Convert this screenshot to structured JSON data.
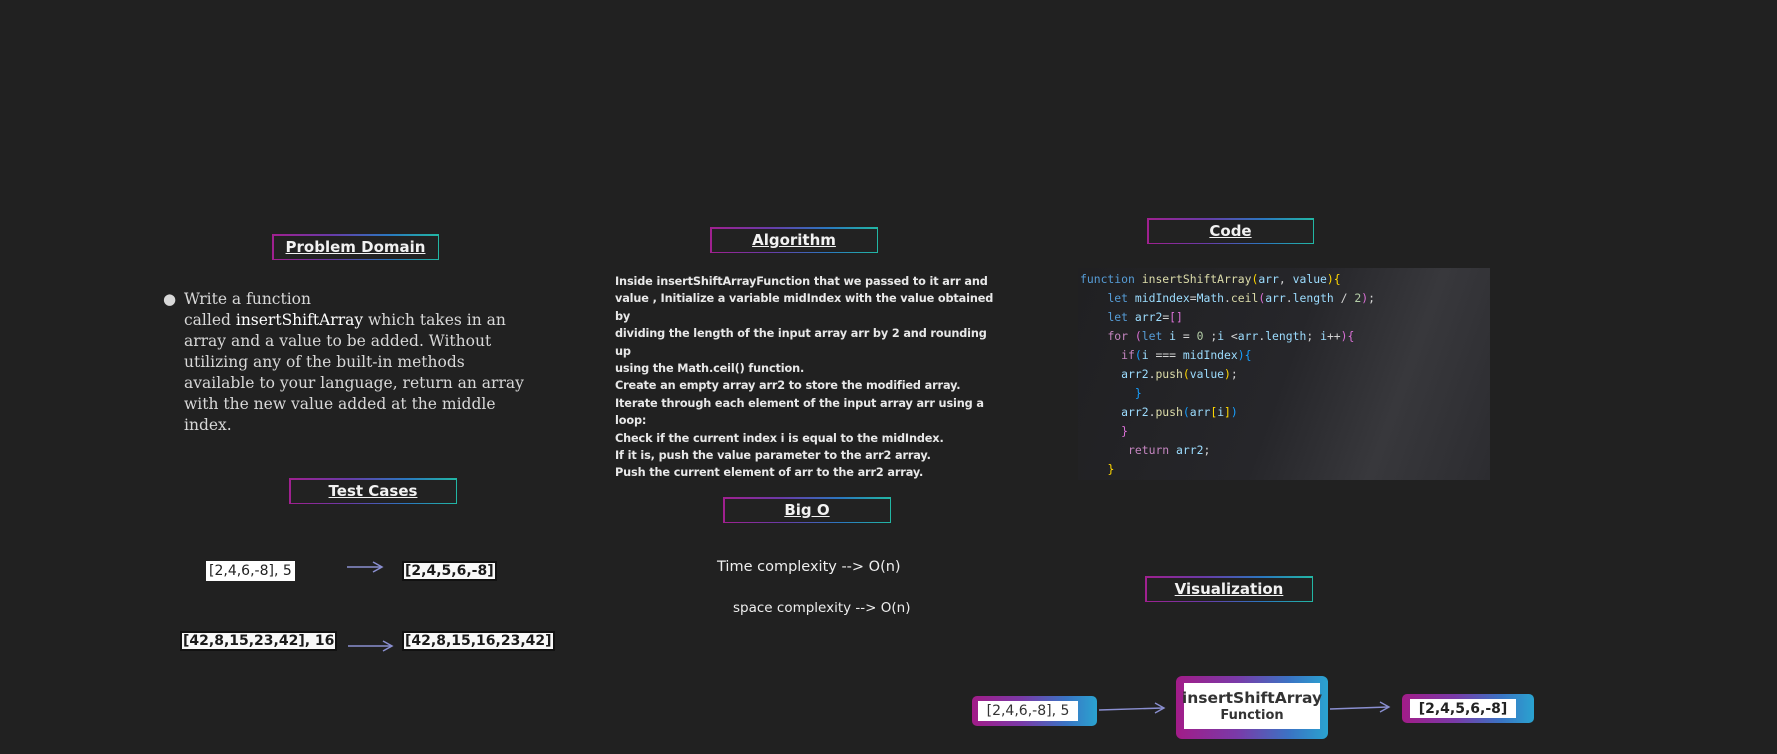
{
  "headers": {
    "problem_domain": "Problem Domain",
    "algorithm": "Algorithm",
    "code": "Code",
    "test_cases": "Test Cases",
    "big_o": "Big O",
    "visualization": "Visualization"
  },
  "problem_domain": {
    "line1": "Write a function",
    "line2_pre": "called ",
    "fn_name": "insertShiftArray",
    "line2_post": " which takes in an",
    "rest": [
      "array and a value to be added. Without",
      "utilizing any of the built-in methods",
      "available to your language, return an array",
      "with the new value added at the middle",
      "index."
    ]
  },
  "algorithm": {
    "lines": [
      "Inside insertShiftArrayFunction that we passed to it arr and",
      "value , Initialize a variable midIndex with the value obtained by",
      "dividing the length of the input array arr by 2 and rounding up",
      "using the Math.ceil() function.",
      "Create an empty array arr2 to store the modified array.",
      "Iterate through each element of the input array arr using a",
      "loop:",
      "Check if the current index i is equal to the midIndex.",
      "If it is, push the value parameter to the arr2 array.",
      "Push the current element of arr to the arr2 array."
    ]
  },
  "code": {
    "lines": [
      "function insertShiftArray(arr, value){",
      "    let midIndex=Math.ceil(arr.length / 2);",
      "    let arr2=[]",
      "    for (let i = 0 ;i <arr.length; i++){",
      "      if(i === midIndex){",
      "      arr2.push(value);",
      "        }",
      "      arr2.push(arr[i])",
      "      }",
      "       return arr2;",
      "    }"
    ]
  },
  "test_cases": [
    {
      "input": "[2,4,6,-8], 5",
      "output": "[2,4,5,6,-8]"
    },
    {
      "input": "[42,8,15,23,42], 16",
      "output": "[42,8,15,16,23,42]"
    }
  ],
  "big_o": {
    "time": "Time complexity --> O(n)",
    "space": "space complexity --> O(n)"
  },
  "visualization": {
    "input": "[2,4,6,-8], 5",
    "function_name": "insertShiftArray",
    "function_label": "Function",
    "output": "[2,4,5,6,-8]"
  },
  "colors": {
    "background": "#212121",
    "gradient_start": "#a0208f",
    "gradient_end": "#22b7a4"
  }
}
